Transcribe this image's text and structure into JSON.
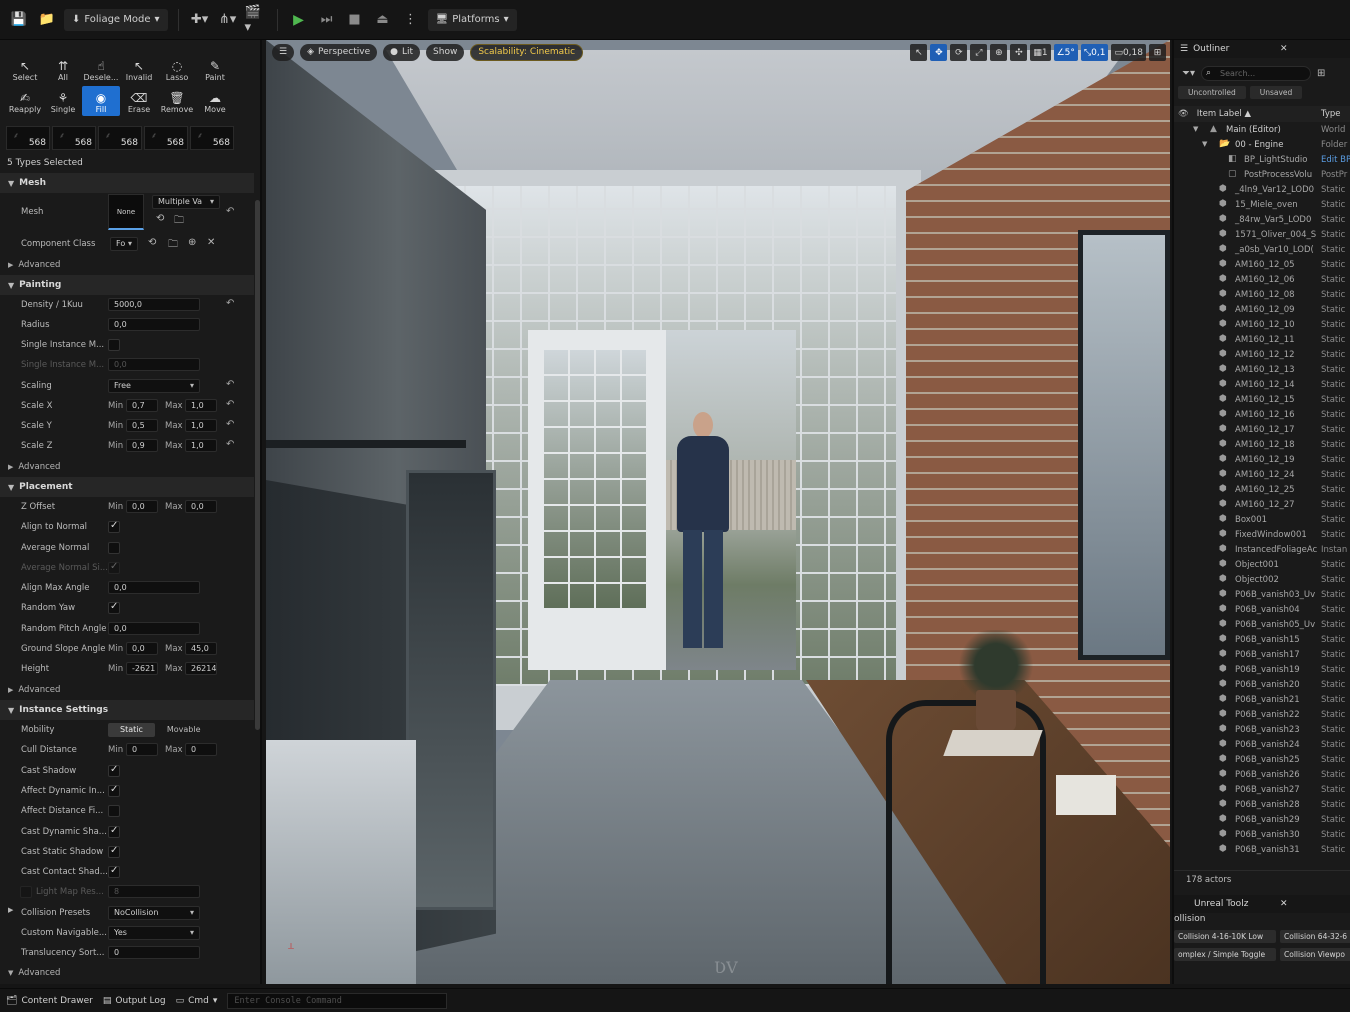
{
  "toolbar": {
    "mode_label": "Foliage Mode",
    "platforms_label": "Platforms"
  },
  "tools": {
    "row1": [
      "Select",
      "All",
      "Desele...",
      "Invalid",
      "Lasso",
      "Paint"
    ],
    "row2": [
      "Reapply",
      "Single",
      "Fill",
      "Erase",
      "Remove",
      "Move"
    ],
    "active": "Fill"
  },
  "thumbnails": [
    "568",
    "568",
    "568",
    "568",
    "568"
  ],
  "types_selected": "5 Types Selected",
  "mesh": {
    "section": "Mesh",
    "mesh_label": "Mesh",
    "mesh_value": "None",
    "mesh_dropdown": "Multiple Va",
    "component_class_label": "Component Class",
    "component_class_value": "Fo",
    "advanced": "Advanced"
  },
  "painting": {
    "section": "Painting",
    "density_label": "Density / 1Kuu",
    "density_value": "5000,0",
    "radius_label": "Radius",
    "radius_value": "0,0",
    "single_instance_label": "Single Instance M...",
    "single_instance2_label": "Single Instance M...",
    "single_instance2_value": "0,0",
    "scaling_label": "Scaling",
    "scaling_value": "Free",
    "scale_x_label": "Scale X",
    "scale_x_min": "0,7",
    "scale_x_max": "1,0",
    "scale_y_label": "Scale Y",
    "scale_y_min": "0,5",
    "scale_y_max": "1,0",
    "scale_z_label": "Scale Z",
    "scale_z_min": "0,9",
    "scale_z_max": "1,0",
    "min": "Min",
    "max": "Max",
    "advanced": "Advanced"
  },
  "placement": {
    "section": "Placement",
    "z_offset_label": "Z Offset",
    "z_offset_min": "0,0",
    "z_offset_max": "0,0",
    "align_normal_label": "Align to Normal",
    "average_normal_label": "Average Normal",
    "average_normal_si_label": "Average Normal Si...",
    "align_max_angle_label": "Align Max Angle",
    "align_max_angle_value": "0,0",
    "random_yaw_label": "Random Yaw",
    "random_pitch_label": "Random Pitch Angle",
    "random_pitch_value": "0,0",
    "ground_slope_label": "Ground Slope Angle",
    "ground_slope_min": "0,0",
    "ground_slope_max": "45,0",
    "height_label": "Height",
    "height_min": "-2621",
    "height_max": "26214",
    "advanced": "Advanced"
  },
  "instance": {
    "section": "Instance Settings",
    "mobility_label": "Mobility",
    "mobility_static": "Static",
    "mobility_movable": "Movable",
    "cull_distance_label": "Cull Distance",
    "cull_min": "0",
    "cull_max": "0",
    "cast_shadow_label": "Cast Shadow",
    "affect_dynamic_label": "Affect Dynamic In...",
    "affect_distance_label": "Affect Distance Fi...",
    "cast_dynamic_label": "Cast Dynamic Sha...",
    "cast_static_label": "Cast Static Shadow",
    "cast_contact_label": "Cast Contact Shad...",
    "light_map_label": "Light Map Res...",
    "light_map_value": "8",
    "collision_presets_label": "Collision Presets",
    "collision_presets_value": "NoCollision",
    "custom_navigable_label": "Custom Navigable...",
    "custom_navigable_value": "Yes",
    "translucency_label": "Translucency Sort...",
    "translucency_value": "0",
    "advanced": "Advanced"
  },
  "viewport": {
    "perspective": "Perspective",
    "lit": "Lit",
    "show": "Show",
    "scalability": "Scalability: Cinematic",
    "grid_value": "1",
    "angle_value": "5°",
    "scale_value": "0,1",
    "camera_value": "0,18"
  },
  "outliner": {
    "title": "Outliner",
    "search_placeholder": "Search...",
    "filter_uncontrolled": "Uncontrolled",
    "filter_unsaved": "Unsaved",
    "col_label": "Item Label ▲",
    "col_type": "Type",
    "items": [
      {
        "name": "Main (Editor)",
        "type": "World",
        "indent": 0
      },
      {
        "name": "00 - Engine",
        "type": "Folder",
        "indent": 1
      },
      {
        "name": "BP_LightStudio",
        "type": "Edit BP",
        "indent": 2
      },
      {
        "name": "PostProcessVolu",
        "type": "PostPr",
        "indent": 2
      },
      {
        "name": "_4ln9_Var12_LOD0",
        "type": "Static",
        "indent": 1
      },
      {
        "name": "15_Miele_oven",
        "type": "Static",
        "indent": 1
      },
      {
        "name": "_84rw_Var5_LOD0",
        "type": "Static",
        "indent": 1
      },
      {
        "name": "1571_Oliver_004_S",
        "type": "Static",
        "indent": 1
      },
      {
        "name": "_a0sb_Var10_LOD(",
        "type": "Static",
        "indent": 1
      },
      {
        "name": "AM160_12_05",
        "type": "Static",
        "indent": 1
      },
      {
        "name": "AM160_12_06",
        "type": "Static",
        "indent": 1
      },
      {
        "name": "AM160_12_08",
        "type": "Static",
        "indent": 1
      },
      {
        "name": "AM160_12_09",
        "type": "Static",
        "indent": 1
      },
      {
        "name": "AM160_12_10",
        "type": "Static",
        "indent": 1
      },
      {
        "name": "AM160_12_11",
        "type": "Static",
        "indent": 1
      },
      {
        "name": "AM160_12_12",
        "type": "Static",
        "indent": 1
      },
      {
        "name": "AM160_12_13",
        "type": "Static",
        "indent": 1
      },
      {
        "name": "AM160_12_14",
        "type": "Static",
        "indent": 1
      },
      {
        "name": "AM160_12_15",
        "type": "Static",
        "indent": 1
      },
      {
        "name": "AM160_12_16",
        "type": "Static",
        "indent": 1
      },
      {
        "name": "AM160_12_17",
        "type": "Static",
        "indent": 1
      },
      {
        "name": "AM160_12_18",
        "type": "Static",
        "indent": 1
      },
      {
        "name": "AM160_12_19",
        "type": "Static",
        "indent": 1
      },
      {
        "name": "AM160_12_24",
        "type": "Static",
        "indent": 1
      },
      {
        "name": "AM160_12_25",
        "type": "Static",
        "indent": 1
      },
      {
        "name": "AM160_12_27",
        "type": "Static",
        "indent": 1
      },
      {
        "name": "Box001",
        "type": "Static",
        "indent": 1
      },
      {
        "name": "FixedWindow001",
        "type": "Static",
        "indent": 1
      },
      {
        "name": "InstancedFoliageAc",
        "type": "Instan",
        "indent": 1
      },
      {
        "name": "Object001",
        "type": "Static",
        "indent": 1
      },
      {
        "name": "Object002",
        "type": "Static",
        "indent": 1
      },
      {
        "name": "P06B_vanish03_Uv",
        "type": "Static",
        "indent": 1
      },
      {
        "name": "P06B_vanish04",
        "type": "Static",
        "indent": 1
      },
      {
        "name": "P06B_vanish05_Uv",
        "type": "Static",
        "indent": 1
      },
      {
        "name": "P06B_vanish15",
        "type": "Static",
        "indent": 1
      },
      {
        "name": "P06B_vanish17",
        "type": "Static",
        "indent": 1
      },
      {
        "name": "P06B_vanish19",
        "type": "Static",
        "indent": 1
      },
      {
        "name": "P06B_vanish20",
        "type": "Static",
        "indent": 1
      },
      {
        "name": "P06B_vanish21",
        "type": "Static",
        "indent": 1
      },
      {
        "name": "P06B_vanish22",
        "type": "Static",
        "indent": 1
      },
      {
        "name": "P06B_vanish23",
        "type": "Static",
        "indent": 1
      },
      {
        "name": "P06B_vanish24",
        "type": "Static",
        "indent": 1
      },
      {
        "name": "P06B_vanish25",
        "type": "Static",
        "indent": 1
      },
      {
        "name": "P06B_vanish26",
        "type": "Static",
        "indent": 1
      },
      {
        "name": "P06B_vanish27",
        "type": "Static",
        "indent": 1
      },
      {
        "name": "P06B_vanish28",
        "type": "Static",
        "indent": 1
      },
      {
        "name": "P06B_vanish29",
        "type": "Static",
        "indent": 1
      },
      {
        "name": "P06B_vanish30",
        "type": "Static",
        "indent": 1
      },
      {
        "name": "P06B_vanish31",
        "type": "Static",
        "indent": 1
      }
    ],
    "actor_count": "178 actors"
  },
  "unreal_toolz": {
    "title": "Unreal Toolz",
    "section": "ollision",
    "btn1": "Collision 4-16-10K Low",
    "btn2": "Collision 64-32-6",
    "btn3": "omplex / Simple Toggle",
    "btn4": "Collision Viewpo"
  },
  "bottom": {
    "content_drawer": "Content Drawer",
    "output_log": "Output Log",
    "cmd": "Cmd",
    "console_placeholder": "Enter Console Command"
  },
  "colors": {
    "accent": "#1f6fd0",
    "play": "#4fb74f",
    "scalability": "#f0c84a"
  }
}
